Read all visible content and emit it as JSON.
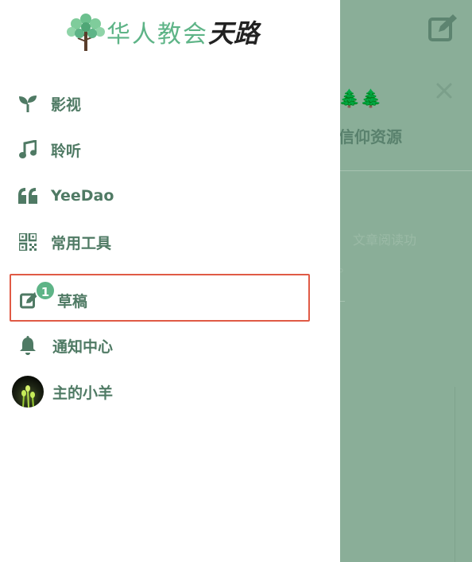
{
  "background": {
    "title": "平台🌲🌲",
    "subtitle": "质信仰资源",
    "text1": "文章阅读功",
    "text2": "。"
  },
  "drawer": {
    "logo": {
      "text_green": "华人教会",
      "text_dark": "天路"
    },
    "nav": [
      {
        "label": "影视",
        "icon": "sprout-icon"
      },
      {
        "label": "聆听",
        "icon": "music-note-icon"
      },
      {
        "label": "YeeDao",
        "icon": "quote-icon"
      },
      {
        "label": "常用工具",
        "icon": "qr-code-icon"
      },
      {
        "label": "草稿",
        "icon": "edit-icon",
        "badge": "1"
      },
      {
        "label": "通知中心",
        "icon": "bell-icon"
      },
      {
        "label": "主的小羊",
        "icon": "avatar"
      }
    ]
  },
  "colors": {
    "accent": "#5eb487",
    "label": "#4f7a64",
    "overlay": "#8aae98",
    "highlight": "#e05a45"
  }
}
